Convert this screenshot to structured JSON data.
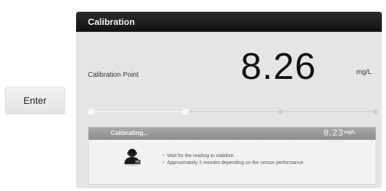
{
  "enter_button": {
    "label": "Enter"
  },
  "panel": {
    "title": "Calibration",
    "calibration_point": {
      "label": "Calibration Point",
      "value": "8.26",
      "unit": "mg/L"
    },
    "progress": {
      "total_points": 4,
      "completed_points": 2
    },
    "status": {
      "text": "Calibrating...",
      "reading": "8.23",
      "unit": "mg/L",
      "icon": "sensor-person-icon",
      "tips": [
        "Wait for the reading to stabilize.",
        "Approximately 2 minutes depending on the sensor performance."
      ]
    }
  },
  "colors": {
    "header": "#1a1a1a",
    "panel_bg": "#e5e5e5",
    "status_bar": "#999999"
  }
}
